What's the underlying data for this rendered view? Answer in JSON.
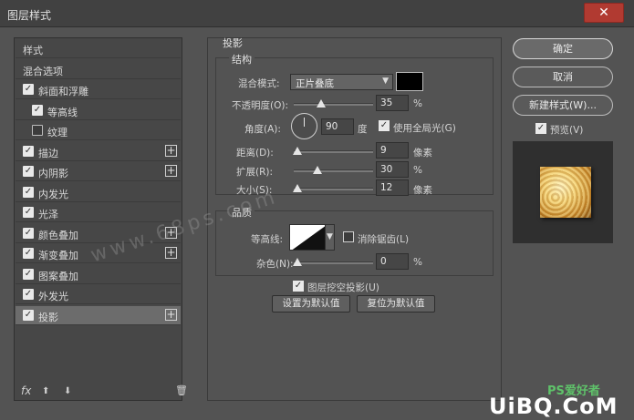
{
  "window": {
    "title": "图层样式",
    "close_glyph": "✕"
  },
  "left": {
    "items": [
      {
        "label": "样式",
        "checkbox": false,
        "checked": false,
        "plus": false,
        "indent": 0,
        "selected": false
      },
      {
        "label": "混合选项",
        "checkbox": false,
        "checked": false,
        "plus": false,
        "indent": 0,
        "selected": false
      },
      {
        "label": "斜面和浮雕",
        "checkbox": true,
        "checked": true,
        "plus": false,
        "indent": 0,
        "selected": false
      },
      {
        "label": "等高线",
        "checkbox": true,
        "checked": true,
        "plus": false,
        "indent": 1,
        "selected": false
      },
      {
        "label": "纹理",
        "checkbox": true,
        "checked": false,
        "plus": false,
        "indent": 1,
        "selected": false
      },
      {
        "label": "描边",
        "checkbox": true,
        "checked": true,
        "plus": true,
        "indent": 0,
        "selected": false
      },
      {
        "label": "内阴影",
        "checkbox": true,
        "checked": true,
        "plus": true,
        "indent": 0,
        "selected": false
      },
      {
        "label": "内发光",
        "checkbox": true,
        "checked": true,
        "plus": false,
        "indent": 0,
        "selected": false
      },
      {
        "label": "光泽",
        "checkbox": true,
        "checked": true,
        "plus": false,
        "indent": 0,
        "selected": false
      },
      {
        "label": "颜色叠加",
        "checkbox": true,
        "checked": true,
        "plus": true,
        "indent": 0,
        "selected": false
      },
      {
        "label": "渐变叠加",
        "checkbox": true,
        "checked": true,
        "plus": true,
        "indent": 0,
        "selected": false
      },
      {
        "label": "图案叠加",
        "checkbox": true,
        "checked": true,
        "plus": false,
        "indent": 0,
        "selected": false
      },
      {
        "label": "外发光",
        "checkbox": true,
        "checked": true,
        "plus": false,
        "indent": 0,
        "selected": false
      },
      {
        "label": "投影",
        "checkbox": true,
        "checked": true,
        "plus": true,
        "indent": 0,
        "selected": true
      }
    ],
    "tools": {
      "fx": "fx",
      "up": "⬆",
      "down": "⬇",
      "trash": "🗑"
    }
  },
  "center": {
    "section_title": "投影",
    "structure": {
      "title": "结构",
      "blend_mode_label": "混合模式:",
      "blend_mode_value": "正片叠底",
      "shadow_color": "#000000",
      "opacity_label": "不透明度(O):",
      "opacity_value": "35",
      "opacity_unit": "%",
      "opacity_level": 35,
      "angle_label": "角度(A):",
      "angle_value": "90",
      "angle_unit": "度",
      "global_light_label": "使用全局光(G)",
      "global_light_checked": true,
      "distance_label": "距离(D):",
      "distance_value": "9",
      "distance_unit": "像素",
      "spread_label": "扩展(R):",
      "spread_value": "30",
      "spread_unit": "%",
      "size_label": "大小(S):",
      "size_value": "12",
      "size_unit": "像素"
    },
    "quality": {
      "title": "品质",
      "contour_label": "等高线:",
      "anti_alias_label": "消除锯齿(L)",
      "anti_alias_checked": false,
      "noise_label": "杂色(N):",
      "noise_value": "0",
      "noise_unit": "%"
    },
    "knockout_label": "图层挖空投影(U)",
    "knockout_checked": true,
    "make_default": "设置为默认值",
    "reset_default": "复位为默认值"
  },
  "right": {
    "ok": "确定",
    "cancel": "取消",
    "new_style": "新建样式(W)...",
    "preview_label": "预览(V)",
    "preview_checked": true
  },
  "overlay": {
    "watermark": "www.68ps.com",
    "logo_top": "PS爱好者",
    "logo_bottom": "UiBQ.CoM"
  }
}
